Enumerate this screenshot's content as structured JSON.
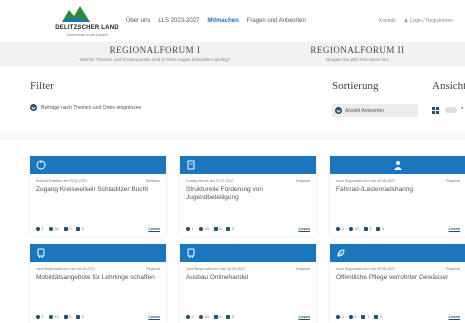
{
  "colors": {
    "accent": "#1b76bd",
    "dark_blue": "#1f4e79",
    "brand_green": "#2b8a3e"
  },
  "brand": {
    "title": "DELITZSCHER LAND",
    "subtitle": "Gemeinsam in die Zukunft"
  },
  "nav": {
    "items": [
      "Über uns",
      "LLS 2023-2027",
      "Mitmachen",
      "Fragen und Antworten"
    ],
    "active": "Mitmachen"
  },
  "util": {
    "contact": "Kontakt",
    "login": "Login / Registrieren"
  },
  "forums": [
    {
      "title": "REGIONALFORUM I",
      "desc": "Welche Themen und Schwerpunkte sind in Ihren Augen besonders wichtig?"
    },
    {
      "title": "REGIONALFORUM II",
      "desc": "Bringen Sie jetzt Ihre Ideen ein!"
    }
  ],
  "filter": {
    "label": "Filter",
    "toggle": "Beiträge nach Themen und Orten eingrenzen"
  },
  "sort": {
    "label": "Sortierung",
    "value": "Anzahl Antworten"
  },
  "view": {
    "label": "Ansicht"
  },
  "read_label": "Lesen",
  "cards": [
    {
      "icon": "wheelchair-icon",
      "meta_left": "Eulinda Draeberr am 25.02.2022",
      "meta_right": "Delitzsch",
      "title": "Zugang Kreiswerkelr Schladitzer Bucht",
      "stats": {
        "comments": "1",
        "views": "36",
        "likes": "0",
        "dislikes": "0"
      }
    },
    {
      "icon": "document-icon",
      "meta_left": "Ludwig Klenke am 21.07.2022",
      "meta_right": "Regional",
      "title": "Strukturelle Förderung von Jugendbeteiligung",
      "stats": {
        "comments": "1",
        "views": "45",
        "likes": "8",
        "dislikes": "0"
      }
    },
    {
      "icon": "person-icon",
      "meta_left": "Input Regionalforum II am 08.08.2022",
      "meta_right": "Regional",
      "title": "Fahrrad-/Lastenradsharing",
      "stats": {
        "comments": "0",
        "views": "20",
        "likes": "3",
        "dislikes": "0"
      }
    },
    {
      "icon": "bus-icon",
      "meta_left": "Input Regionalforum II am 08.08.2022",
      "meta_right": "Regional",
      "title": "Mobilitätsangebote für Lehrlinge schaffen",
      "stats": {
        "comments": "1",
        "views": "16",
        "likes": "5",
        "dislikes": "0"
      }
    },
    {
      "icon": "bus-icon",
      "meta_left": "Input Regionalforum II am 08.08.2022",
      "meta_right": "Regional",
      "title": "Ausbau Onlinehandel",
      "stats": {
        "comments": "0",
        "views": "30",
        "likes": "6",
        "dislikes": "5"
      }
    },
    {
      "icon": "leaf-icon",
      "meta_left": "Input Regionalforum II am 09.08.2022",
      "meta_right": "Regional",
      "title": "Öffentliche Pflege verrohrter Gewässer",
      "stats": {
        "comments": "0",
        "views": "5",
        "likes": "1",
        "dislikes": "2"
      }
    }
  ]
}
